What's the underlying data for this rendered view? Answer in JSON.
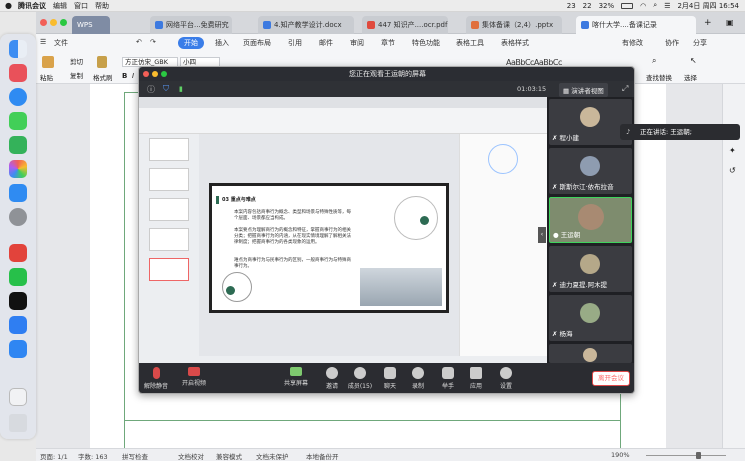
{
  "menubar": {
    "app": "腾讯会议",
    "items": [
      "编辑",
      "窗口",
      "帮助"
    ],
    "badge_a": "23",
    "badge_b": "22",
    "battery": "32%",
    "datetime": "2月4日 周四  16:54"
  },
  "tabs": [
    {
      "label": "WPS"
    },
    {
      "label": "网络平台...免费研究"
    },
    {
      "label": "4.知产教学设计.docx"
    },
    {
      "label": "447 知识产....ocr.pdf"
    },
    {
      "label": "集体备课（2,4）.pptx"
    },
    {
      "label": "喀什大学....备课记录"
    }
  ],
  "ribbon": {
    "tabs": [
      "文件",
      "开始",
      "插入",
      "页面布局",
      "引用",
      "邮件",
      "审阅",
      "章节",
      "特色功能",
      "表格工具",
      "表格样式"
    ],
    "right": [
      "有修改",
      "协作",
      "分享"
    ],
    "tools": {
      "paste": "粘贴",
      "cut": "剪切",
      "copy": "复制",
      "brush": "格式刷",
      "font": "方正仿宋_GBK",
      "size": "小四",
      "find": "查找替换",
      "select": "选择"
    }
  },
  "status": {
    "page": "页面: 1/1",
    "words": "字数: 163",
    "spell": "拼写检查",
    "proof": "文档校对",
    "compat": "兼容模式",
    "unprotected": "文档未保护",
    "backup": "本地备份开",
    "zoom": "190%"
  },
  "meeting": {
    "banner": "您正在观看王运朝的屏幕",
    "timer": "01:03:15",
    "view": "演讲者视图",
    "speaking": "正在讲话: 王运朝;",
    "participants": [
      {
        "name": "程小建"
      },
      {
        "name": "斯斯尔江·依布拉音"
      },
      {
        "name": "王运朝"
      },
      {
        "name": "迪力夏提.阿木提"
      },
      {
        "name": "杨海"
      }
    ],
    "toolbar": {
      "mute": "解除静音",
      "video": "开启视频",
      "share": "共享屏幕",
      "invite": "邀请",
      "members": "成员(15)",
      "chat": "聊天",
      "record": "录制",
      "hand": "举手",
      "apps": "应用",
      "settings": "设置",
      "leave": "离开会议"
    }
  },
  "slide": {
    "heading": "03 重点与难点",
    "body1": "本案内容包括商事行为概念、类型和场景与特殊性质等，每个层面、场景都应当构成。",
    "body2": "本案要点为理解商行为的概念和特征，掌握商事行为的相关分类；把握商事行为的内涵，从在现实情境理解了解相关法律制度；把握商事行为的各类现象的运用。",
    "body3": "难点为商事行为与民事行为的区别，一般商事行为与特殊商事行为。"
  }
}
